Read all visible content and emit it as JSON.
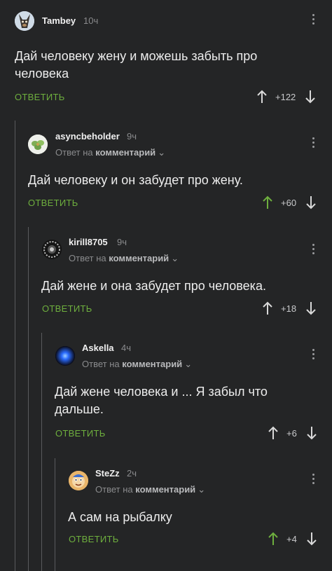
{
  "comments": [
    {
      "username": "Tambey",
      "time": "10ч",
      "reply_to": "",
      "text": "Дай человеку жену и можешь забыть про человека",
      "reply_label": "ОТВЕТИТЬ",
      "rating": "+122",
      "avatar_icon": "dog-avatar-icon",
      "upvote_color": "#d9d9d9"
    },
    {
      "username": "asyncbeholder",
      "time": "9ч",
      "reply_to_prefix": "Ответ на",
      "reply_to": "комментарий",
      "text": "Дай человеку и он забудет про жену.",
      "reply_label": "ОТВЕТИТЬ",
      "rating": "+60",
      "avatar_icon": "plant-avatar-icon",
      "upvote_color": "#6eaf3e"
    },
    {
      "username": "kirill8705",
      "time": "9ч",
      "reply_to_prefix": "Ответ на",
      "reply_to": "комментарий",
      "text": "Дай жене и она забудет про человека.",
      "reply_label": "ОТВЕТИТЬ",
      "rating": "+18",
      "avatar_icon": "badge-avatar-icon",
      "upvote_color": "#d9d9d9"
    },
    {
      "username": "Askella",
      "time": "4ч",
      "reply_to_prefix": "Ответ на",
      "reply_to": "комментарий",
      "text": "Дай жене человека и ... Я забыл что дальше.",
      "reply_label": "ОТВЕТИТЬ",
      "rating": "+6",
      "avatar_icon": "blue-glow-avatar-icon",
      "upvote_color": "#d9d9d9"
    },
    {
      "username": "SteZz",
      "time": "2ч",
      "reply_to_prefix": "Ответ на",
      "reply_to": "комментарий",
      "text": "А сам на рыбалку",
      "reply_label": "ОТВЕТИТЬ",
      "rating": "+4",
      "avatar_icon": "cartoon-avatar-icon",
      "upvote_color": "#6eaf3e"
    }
  ],
  "colors": {
    "background": "#242526",
    "accent_green": "#6eaf3e",
    "thread_line": "#5a5b5d"
  }
}
